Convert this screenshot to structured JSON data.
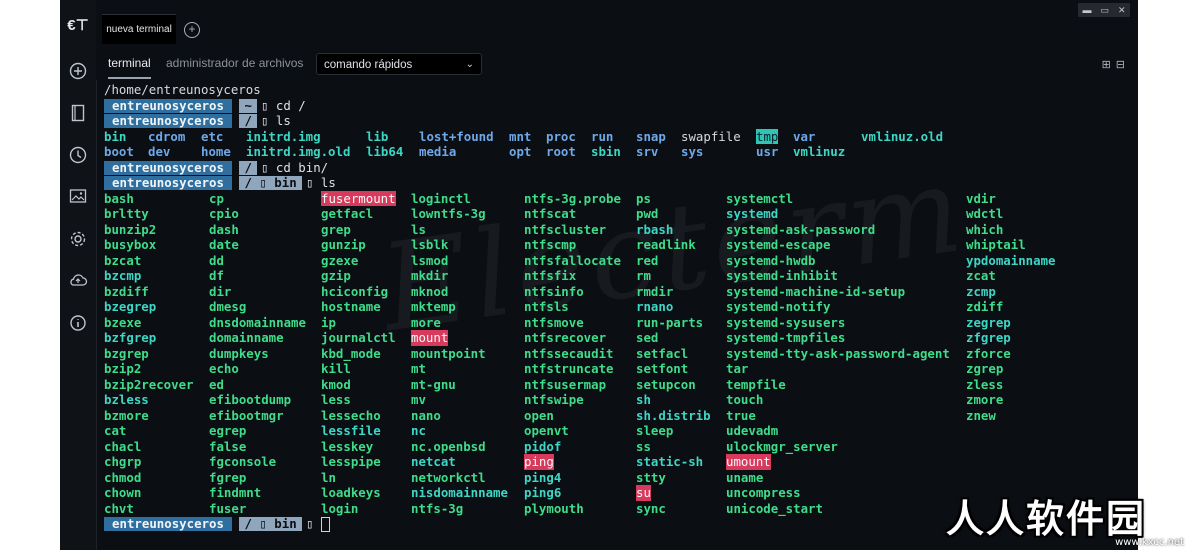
{
  "app": {
    "logo": "€⊤"
  },
  "tabs": [
    {
      "label": "nueva terminal"
    }
  ],
  "subtabs": [
    {
      "label": "terminal",
      "active": true
    },
    {
      "label": "administrador de archivos",
      "active": false
    }
  ],
  "dropdown": {
    "label": "comando rápidos"
  },
  "sidebar_icons": [
    "add-icon",
    "book-icon",
    "history-icon",
    "image-icon",
    "gear-icon",
    "cloud-icon",
    "info-icon"
  ],
  "watermark": "Electerm",
  "site_watermark": {
    "title": "人人软件园",
    "url": "www.kxcc.net"
  },
  "terminal": {
    "prompt_user": "entreunosyceros",
    "cwd_line": "/home/entreunosyceros",
    "commands": [
      {
        "dir": "~",
        "cmd": "cd /"
      },
      {
        "dir": "/",
        "cmd": "ls"
      },
      {
        "dir": "/",
        "cmd": "cd bin/"
      },
      {
        "dir": "/ ▯ bin",
        "cmd": "ls"
      },
      {
        "dir": "/ ▯ bin",
        "cmd": ""
      }
    ],
    "root_listing": [
      [
        {
          "t": "bin",
          "c": "cyan"
        },
        {
          "t": "cdrom",
          "c": "dir"
        },
        {
          "t": "etc",
          "c": "dir"
        },
        {
          "t": "initrd.img",
          "c": "cyan"
        },
        {
          "t": "lib",
          "c": "cyan"
        },
        {
          "t": "lost+found",
          "c": "dir"
        },
        {
          "t": "mnt",
          "c": "dir"
        },
        {
          "t": "proc",
          "c": "dir"
        },
        {
          "t": "run",
          "c": "dir"
        },
        {
          "t": "snap",
          "c": "dir"
        },
        {
          "t": "swapfile",
          "c": "plain"
        },
        {
          "t": "tmp",
          "c": "sticky"
        },
        {
          "t": "var",
          "c": "dir"
        },
        {
          "t": "vmlinuz.old",
          "c": "cyan"
        }
      ],
      [
        {
          "t": "boot",
          "c": "dir"
        },
        {
          "t": "dev",
          "c": "dir"
        },
        {
          "t": "home",
          "c": "dir"
        },
        {
          "t": "initrd.img.old",
          "c": "cyan"
        },
        {
          "t": "lib64",
          "c": "cyan"
        },
        {
          "t": "media",
          "c": "dir"
        },
        {
          "t": "opt",
          "c": "dir"
        },
        {
          "t": "root",
          "c": "dir"
        },
        {
          "t": "sbin",
          "c": "cyan"
        },
        {
          "t": "srv",
          "c": "dir"
        },
        {
          "t": "sys",
          "c": "dir"
        },
        {
          "t": "usr",
          "c": "dir"
        },
        {
          "t": "vmlinuz",
          "c": "cyan"
        }
      ]
    ],
    "bin_columns": [
      [
        "bash",
        "brltty",
        "bunzip2",
        "busybox",
        "bzcat",
        "bzcmp",
        "bzdiff",
        "bzegrep",
        "bzexe",
        "bzfgrep",
        "bzgrep",
        "bzip2",
        "bzip2recover",
        "bzless",
        "bzmore",
        "cat",
        "chacl",
        "chgrp",
        "chmod",
        "chown",
        "chvt"
      ],
      [
        "cp",
        "cpio",
        "dash",
        "date",
        "dd",
        "df",
        "dir",
        "dmesg",
        "dnsdomainname",
        "domainname",
        "dumpkeys",
        "echo",
        "ed",
        "efibootdump",
        "efibootmgr",
        "egrep",
        "false",
        "fgconsole",
        "fgrep",
        "findmnt",
        "fuser"
      ],
      [
        "fusermount",
        "getfacl",
        "grep",
        "gunzip",
        "gzexe",
        "gzip",
        "hciconfig",
        "hostname",
        "ip",
        "journalctl",
        "kbd_mode",
        "kill",
        "kmod",
        "less",
        "lessecho",
        "lessfile",
        "lesskey",
        "lesspipe",
        "ln",
        "loadkeys",
        "login"
      ],
      [
        "loginctl",
        "lowntfs-3g",
        "ls",
        "lsblk",
        "lsmod",
        "mkdir",
        "mknod",
        "mktemp",
        "more",
        "mount",
        "mountpoint",
        "mt",
        "mt-gnu",
        "mv",
        "nano",
        "nc",
        "nc.openbsd",
        "netcat",
        "networkctl",
        "nisdomainname",
        "ntfs-3g"
      ],
      [
        "ntfs-3g.probe",
        "ntfscat",
        "ntfscluster",
        "ntfscmp",
        "ntfsfallocate",
        "ntfsfix",
        "ntfsinfo",
        "ntfsls",
        "ntfsmove",
        "ntfsrecover",
        "ntfssecaudit",
        "ntfstruncate",
        "ntfsusermap",
        "ntfswipe",
        "open",
        "openvt",
        "pidof",
        "ping",
        "ping4",
        "ping6",
        "plymouth"
      ],
      [
        "ps",
        "pwd",
        "rbash",
        "readlink",
        "red",
        "rm",
        "rmdir",
        "rnano",
        "run-parts",
        "sed",
        "setfacl",
        "setfont",
        "setupcon",
        "sh",
        "sh.distrib",
        "sleep",
        "ss",
        "static-sh",
        "stty",
        "su",
        "sync"
      ],
      [
        "systemctl",
        "systemd",
        "systemd-ask-password",
        "systemd-escape",
        "systemd-hwdb",
        "systemd-inhibit",
        "systemd-machine-id-setup",
        "systemd-notify",
        "systemd-sysusers",
        "systemd-tmpfiles",
        "systemd-tty-ask-password-agent",
        "tar",
        "tempfile",
        "touch",
        "true",
        "udevadm",
        "ulockmgr_server",
        "umount",
        "uname",
        "uncompress",
        "unicode_start"
      ],
      [
        "vdir",
        "wdctl",
        "which",
        "whiptail",
        "ypdomainname",
        "zcat",
        "zcmp",
        "zdiff",
        "zegrep",
        "zfgrep",
        "zforce",
        "zgrep",
        "zless",
        "zmore",
        "znew"
      ]
    ],
    "bin_suid": [
      "fusermount",
      "mount",
      "ping",
      "su",
      "umount"
    ],
    "bin_cyan": [
      "bzcmp",
      "bzegrep",
      "bzfgrep",
      "bzless",
      "lessfile",
      "nc",
      "netcat",
      "nisdomainname",
      "pidof",
      "ping4",
      "ping6",
      "rbash",
      "rnano",
      "sh",
      "sh.distrib",
      "static-sh",
      "systemd",
      "ypdomainname",
      "zcmp",
      "zegrep",
      "zfgrep"
    ],
    "colors": {
      "exec": "#3fdc8a",
      "link": "#3ed6c4",
      "suid_bg": "#d63a5c",
      "prompt_user_bg": "#2e6f9f",
      "prompt_dir_bg": "#8fa6bd"
    }
  }
}
